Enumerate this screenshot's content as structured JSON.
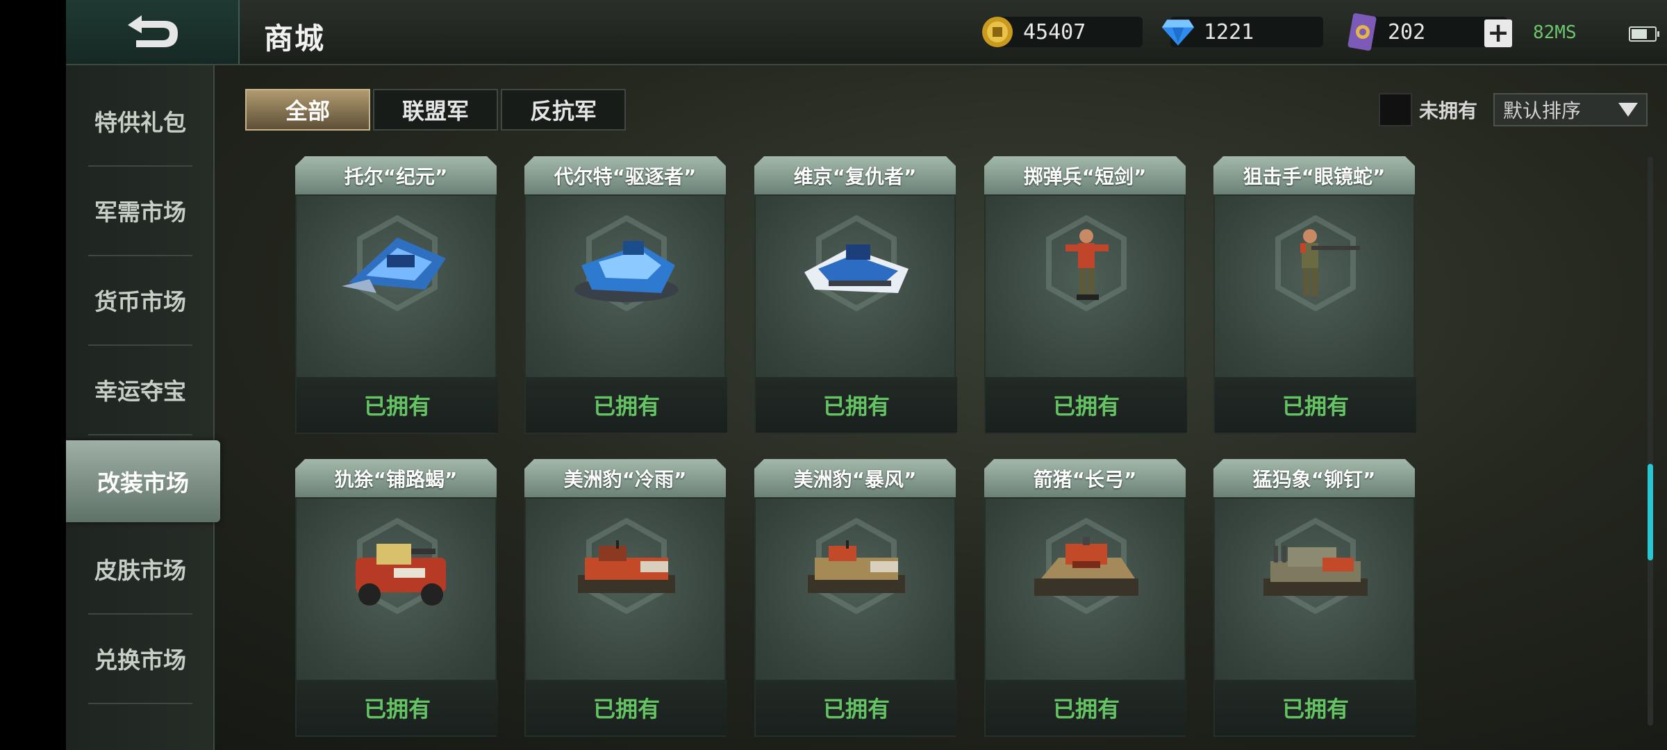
{
  "header": {
    "title": "商城",
    "gold": "45407",
    "diamonds": "1221",
    "cards": "202",
    "plus": "+",
    "ping": "82MS"
  },
  "sidebar": {
    "items": [
      {
        "label": "特供礼包"
      },
      {
        "label": "军需市场"
      },
      {
        "label": "货币市场"
      },
      {
        "label": "幸运夺宝"
      },
      {
        "label": "改装市场",
        "active": true
      },
      {
        "label": "皮肤市场"
      },
      {
        "label": "兑换市场"
      }
    ]
  },
  "tabs": [
    {
      "label": "全部",
      "active": true
    },
    {
      "label": "联盟军"
    },
    {
      "label": "反抗军"
    }
  ],
  "filter": {
    "owned_label": "未拥有"
  },
  "sort": {
    "label": "默认排序"
  },
  "scroll": {
    "position_fraction": 0.4,
    "visible_fraction": 0.17
  },
  "items": [
    {
      "name": "托尔“纪元”",
      "status": "已拥有",
      "icon": "blue-jet-icon",
      "faction": "allied"
    },
    {
      "name": "代尔特“驱逐者”",
      "status": "已拥有",
      "icon": "blue-hovercraft-icon",
      "faction": "allied"
    },
    {
      "name": "维京“复仇者”",
      "status": "已拥有",
      "icon": "blue-boat-icon",
      "faction": "allied"
    },
    {
      "name": "掷弹兵“短剑”",
      "status": "已拥有",
      "icon": "grenadier-soldier-icon",
      "faction": "rebel"
    },
    {
      "name": "狙击手“眼镜蛇”",
      "status": "已拥有",
      "icon": "sniper-soldier-icon",
      "faction": "rebel"
    },
    {
      "name": "犰狳“铺路蝎”",
      "status": "已拥有",
      "icon": "red-armored-car-icon",
      "faction": "rebel"
    },
    {
      "name": "美洲豹“冷雨”",
      "status": "已拥有",
      "icon": "red-rocket-tank-icon",
      "faction": "rebel"
    },
    {
      "name": "美洲豹“暴风”",
      "status": "已拥有",
      "icon": "tan-rocket-tank-icon",
      "faction": "rebel"
    },
    {
      "name": "箭猪“长弓”",
      "status": "已拥有",
      "icon": "red-heavy-tank-icon",
      "faction": "rebel"
    },
    {
      "name": "猛犸象“铆钉”",
      "status": "已拥有",
      "icon": "mammoth-tank-icon",
      "faction": "rebel"
    }
  ],
  "colors": {
    "owned_text": "#64c463",
    "accent_scroll": "#29c7d3",
    "allied_blue": "#3a8fe0",
    "rebel_red": "#d0452a"
  }
}
